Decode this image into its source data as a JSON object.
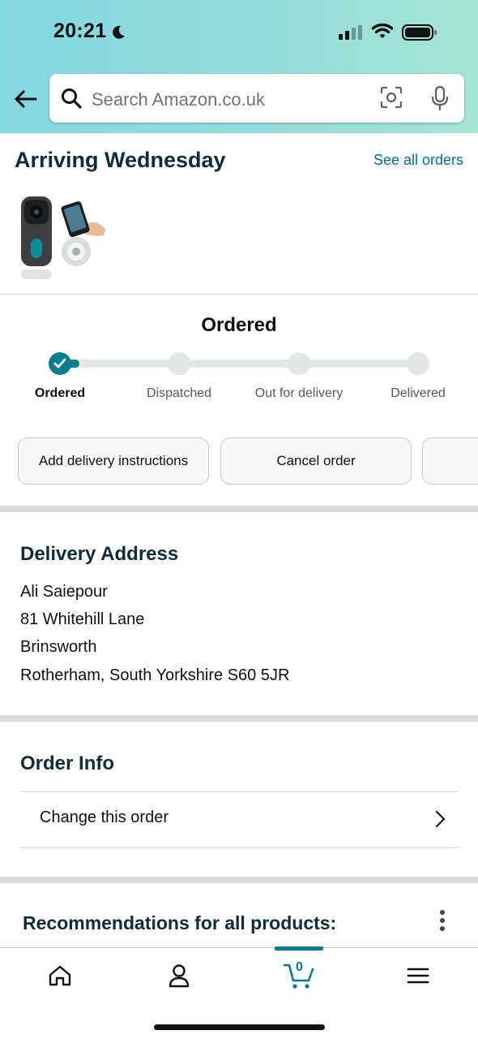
{
  "status_bar": {
    "time": "20:21",
    "icons": [
      "moon-icon",
      "signal-icon",
      "wifi-icon",
      "battery-icon"
    ]
  },
  "search": {
    "placeholder": "Search Amazon.co.uk",
    "icons": [
      "back-arrow-icon",
      "search-icon",
      "camera-scan-icon",
      "microphone-icon"
    ]
  },
  "shipment": {
    "heading": "Arriving Wednesday",
    "see_all": "See all orders",
    "product_image": "video-doorbell-product-image"
  },
  "tracking": {
    "title": "Ordered",
    "steps": [
      {
        "label": "Ordered",
        "done": true
      },
      {
        "label": "Dispatched",
        "done": false
      },
      {
        "label": "Out for delivery",
        "done": false
      },
      {
        "label": "Delivered",
        "done": false
      }
    ]
  },
  "actions": {
    "add_instructions": "Add delivery instructions",
    "cancel": "Cancel order",
    "third": ""
  },
  "delivery": {
    "title": "Delivery Address",
    "lines": [
      "Ali Saiepour",
      "81 Whitehill Lane",
      "Brinsworth",
      "Rotherham, South Yorkshire S60 5JR"
    ]
  },
  "order_info": {
    "title": "Order Info",
    "change": "Change this order"
  },
  "recommendations": {
    "title": "Recommendations for all products:"
  },
  "tabbar": {
    "tabs": [
      "home-icon",
      "account-icon",
      "cart-icon",
      "menu-icon"
    ],
    "cart_count": "0",
    "active": "cart"
  },
  "colors": {
    "accent": "#067d8c",
    "link": "#007185",
    "heading": "#0f2d38"
  }
}
